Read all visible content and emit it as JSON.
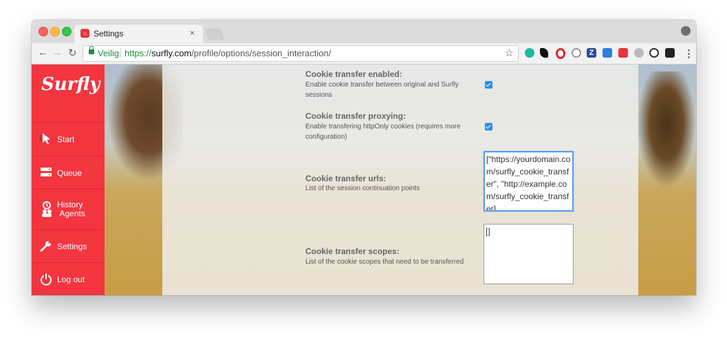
{
  "browser": {
    "tab_title": "Settings",
    "tab_close": "×",
    "secure_label": "Veilig",
    "url_scheme": "https://",
    "url_host": "surfly.com",
    "url_path": "/profile/options/session_interaction/",
    "extensions": [
      "teal-circle",
      "wolf",
      "opera",
      "ring",
      "zotero",
      "box",
      "surfly",
      "cloud",
      "info",
      "check"
    ]
  },
  "sidebar": {
    "logo": "Surfly",
    "items": [
      {
        "label": "Start",
        "icon": "cursor-icon"
      },
      {
        "label": "Queue",
        "icon": "server-icon"
      },
      {
        "label": "History Agents",
        "line1": "History",
        "line2": "Agents",
        "icon": "agents-icon"
      },
      {
        "label": "Settings",
        "icon": "wrench-icon"
      },
      {
        "label": "Log out",
        "icon": "power-icon"
      }
    ]
  },
  "form": {
    "cookie_transfer_enabled": {
      "title": "Cookie transfer enabled:",
      "help": "Enable cookie transfer between original and Surfly sessions",
      "checked": true
    },
    "cookie_transfer_proxying": {
      "title": "Cookie transfer proxying:",
      "help": "Enable transfering httpOnly cookies (requires more configuration)",
      "checked": true
    },
    "cookie_transfer_urls": {
      "title": "Cookie transfer urls:",
      "help": "List of the session continuation points",
      "value": "[\"https://yourdomain.com/surfly_cookie_transfer\", \"http://example.com/surfly_cookie_transfer]"
    },
    "cookie_transfer_scopes": {
      "title": "Cookie transfer scopes:",
      "help": "List of the cookie scopes that need to be transferred",
      "value": "[]"
    }
  },
  "colors": {
    "accent": "#f2353f",
    "checkbox": "#2b8ef0",
    "url_green": "#1e8e3e"
  }
}
